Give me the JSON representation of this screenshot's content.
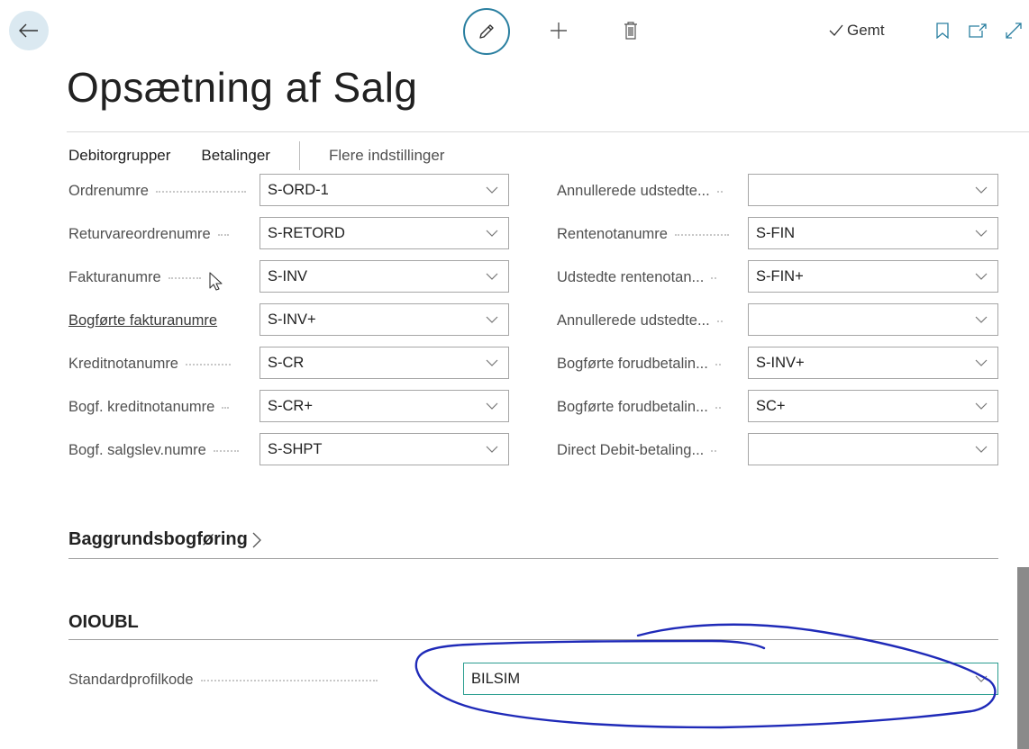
{
  "toolbar": {
    "back_icon": "arrow-left-icon",
    "edit_icon": "pencil-icon",
    "new_icon": "plus-icon",
    "delete_icon": "trash-icon",
    "saved_label": "Gemt",
    "bookmark_icon": "bookmark-icon",
    "open_new_window_icon": "open-in-new-window-icon",
    "expand_icon": "expand-icon"
  },
  "page": {
    "title": "Opsætning af Salg"
  },
  "actions": [
    {
      "label": "Debitorgrupper"
    },
    {
      "label": "Betalinger"
    },
    {
      "label": "Flere indstillinger"
    }
  ],
  "number_series_left": [
    {
      "label": "Ordrenumre",
      "value": "S-ORD-1",
      "link": false
    },
    {
      "label": "Returvareordrenumre",
      "value": "S-RETORD",
      "link": false
    },
    {
      "label": "Fakturanumre",
      "value": "S-INV",
      "link": false
    },
    {
      "label": "Bogførte fakturanumre",
      "value": "S-INV+",
      "link": true
    },
    {
      "label": "Kreditnotanumre",
      "value": "S-CR",
      "link": false
    },
    {
      "label": "Bogf. kreditnotanumre",
      "value": "S-CR+",
      "link": false
    },
    {
      "label": "Bogf. salgslev.numre",
      "value": "S-SHPT",
      "link": false
    }
  ],
  "number_series_right": [
    {
      "label": "Annullerede udstedte...",
      "value": ""
    },
    {
      "label": "Rentenotanumre",
      "value": "S-FIN"
    },
    {
      "label": "Udstedte rentenotan...",
      "value": "S-FIN+"
    },
    {
      "label": "Annullerede udstedte...",
      "value": ""
    },
    {
      "label": "Bogførte forudbetalin...",
      "value": "S-INV+"
    },
    {
      "label": "Bogførte forudbetalin...",
      "value": "SC+"
    },
    {
      "label": "Direct Debit-betaling...",
      "value": ""
    }
  ],
  "sections": {
    "background_posting": "Baggrundsbogføring",
    "oioubl": "OIOUBL"
  },
  "oioubl": {
    "label": "Standardprofilkode",
    "value": "BILSIM"
  },
  "colors": {
    "accent": "#2a7fa0",
    "focus_border": "#2a9d8f",
    "annotation": "#1f2ab8",
    "back_button_bg": "#dbe9f1"
  }
}
